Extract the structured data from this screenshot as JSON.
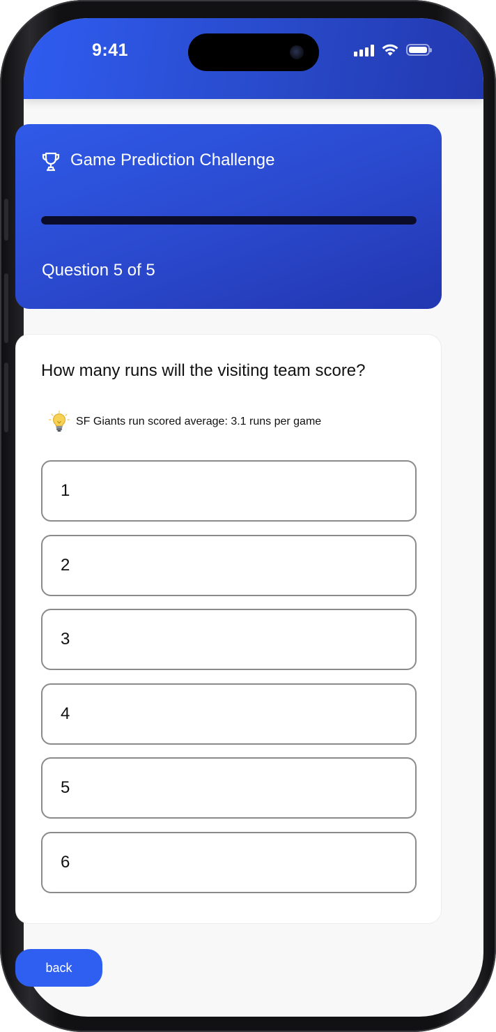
{
  "status_bar": {
    "time": "9:41",
    "icons": [
      "cellular-signal-icon",
      "wifi-icon",
      "battery-icon"
    ]
  },
  "header": {
    "icon": "trophy-icon",
    "title": "Game Prediction Challenge",
    "progress_fraction": 1.0,
    "question_count": "Question 5 of 5"
  },
  "question": {
    "text": "How many runs will the visiting team score?",
    "hint_icon": "lightbulb-icon",
    "hint": "SF Giants run scored average: 3.1 runs per game",
    "options": [
      "1",
      "2",
      "3",
      "4",
      "5",
      "6"
    ]
  },
  "footer": {
    "back_label": "back"
  },
  "colors": {
    "primary": "#2f5ff0",
    "header_gradient_start": "#2f5ae8",
    "header_gradient_end": "#2236b0",
    "progress_fill": "#0b0b2a",
    "option_border": "#8a8a8a"
  }
}
